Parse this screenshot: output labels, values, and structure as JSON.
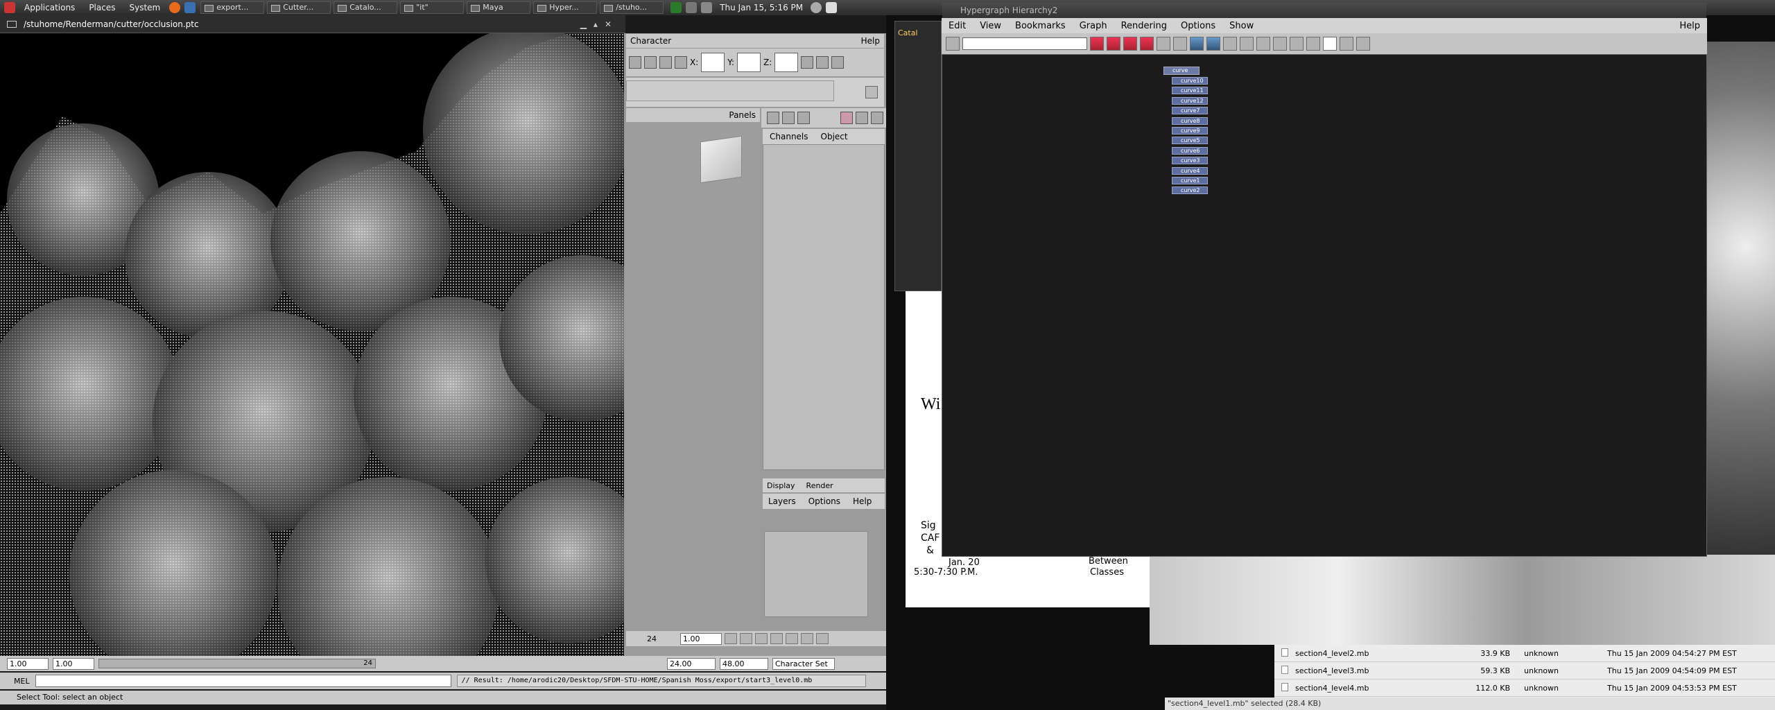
{
  "top_panel": {
    "menus": [
      "Applications",
      "Places",
      "System"
    ],
    "tasks": [
      "export...",
      "Cutter...",
      "Catalo...",
      "\"it\"",
      "Maya",
      "Hyper...",
      "/stuho..."
    ],
    "clock": "Thu Jan 15,  5:16 PM"
  },
  "cutter": {
    "title": "/stuhome/Renderman/cutter/occlusion.ptc"
  },
  "maya": {
    "character_label": "Character",
    "help_label": "Help",
    "x_label": "X:",
    "y_label": "Y:",
    "z_label": "Z:",
    "panels_label": "Panels",
    "channels_tab": "Channels",
    "object_tab": "Object",
    "display_tab": "Display",
    "render_tab": "Render",
    "layers_menu": "Layers",
    "options_menu": "Options",
    "layers_help": "Help",
    "current_time": "1.00",
    "time_tick": "24",
    "range_start": "1.00",
    "range_start2": "1.00",
    "range_tick": "24",
    "range_end": "24.00",
    "range_max": "48.00",
    "character_set": "Character Set",
    "mel_label": "MEL",
    "mel_result": "// Result: /home/arodic20/Desktop/SFDM-STU-HOME/Spanish Moss/export/start3_level0.mb",
    "help_line": "Select Tool: select an object"
  },
  "hypergraph": {
    "title": "Hypergraph Hierarchy2",
    "menus": [
      "Edit",
      "View",
      "Bookmarks",
      "Graph",
      "Rendering",
      "Options",
      "Show"
    ],
    "help": "Help",
    "root_node": "curve",
    "nodes": [
      "curve10",
      "curve11",
      "curve12",
      "curve7",
      "curve8",
      "curve9",
      "curve5",
      "curve6",
      "curve3",
      "curve4",
      "curve1",
      "curve2"
    ]
  },
  "background": {
    "catalog_label": "Catal",
    "doc_text_1": "Wi",
    "doc_text_2": "Sig",
    "doc_text_3": "CAF",
    "doc_text_4": "&",
    "doc_date": "Jan. 20",
    "doc_time": "5:30-7:30 P.M.",
    "doc_between": "Between",
    "doc_classes": "Classes"
  },
  "files": [
    {
      "name": "section4_level2.mb",
      "size": "33.9 KB",
      "type": "unknown",
      "date": "Thu 15 Jan 2009 04:54:27 PM EST"
    },
    {
      "name": "section4_level3.mb",
      "size": "59.3 KB",
      "type": "unknown",
      "date": "Thu 15 Jan 2009 04:54:09 PM EST"
    },
    {
      "name": "section4_level4.mb",
      "size": "112.0 KB",
      "type": "unknown",
      "date": "Thu 15 Jan 2009 04:53:53 PM EST"
    }
  ],
  "selected_status": "\"section4_level1.mb\" selected (28.4 KB)"
}
